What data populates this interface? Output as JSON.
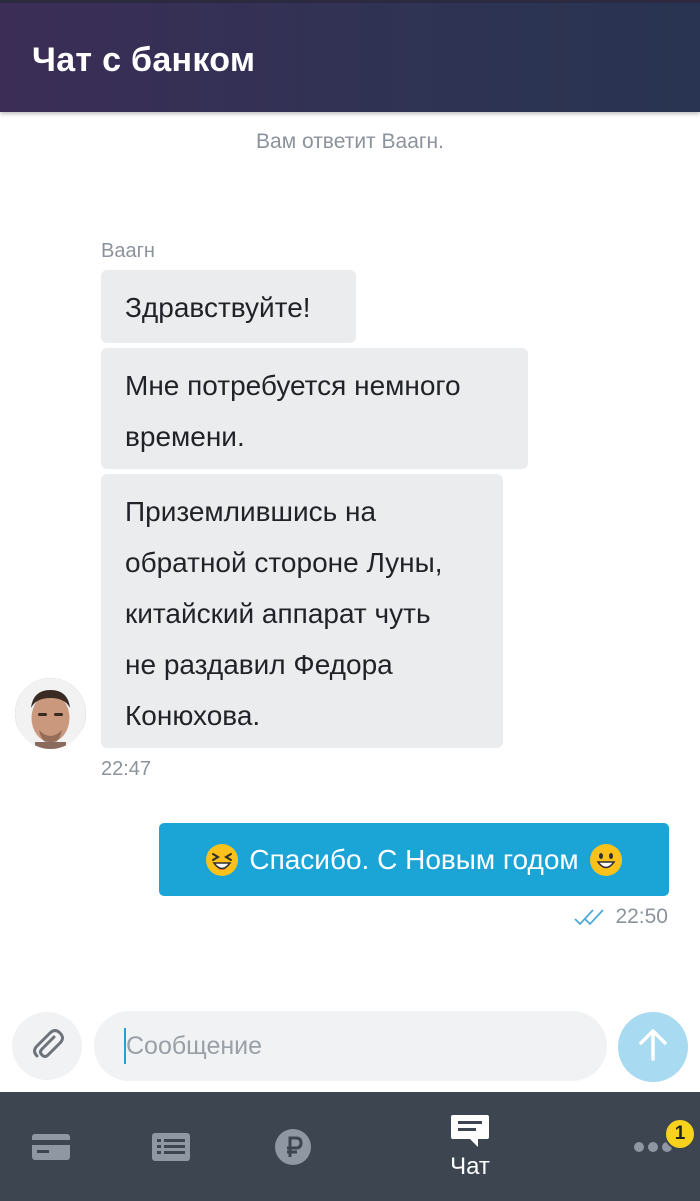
{
  "header": {
    "title": "Чат с банком"
  },
  "chat": {
    "system_note": "Вам ответит Ваагн.",
    "incoming": {
      "sender": "Ваагн",
      "messages": [
        "Здравствуйте!",
        "Мне потребуется немного\nвремени.",
        "Приземлившись на\nобратной стороне Луны,\nкитайский аппарат чуть\nне раздавил Федора\nКонюхова."
      ],
      "time": "22:47"
    },
    "outgoing": {
      "text": "Спасибо. С Новым годом",
      "time": "22:50",
      "status": "read"
    }
  },
  "composer": {
    "placeholder": "Сообщение"
  },
  "bottom_nav": {
    "items": [
      {
        "icon": "card-icon"
      },
      {
        "icon": "list-icon"
      },
      {
        "icon": "ruble-icon"
      },
      {
        "icon": "chat-icon",
        "label": "Чат",
        "active": true
      },
      {
        "icon": "more-icon",
        "badge": "1"
      }
    ]
  },
  "colors": {
    "accent": "#1ba5d6",
    "header": "#2f3354",
    "nav": "#3d4550",
    "badge": "#f8d21c"
  }
}
